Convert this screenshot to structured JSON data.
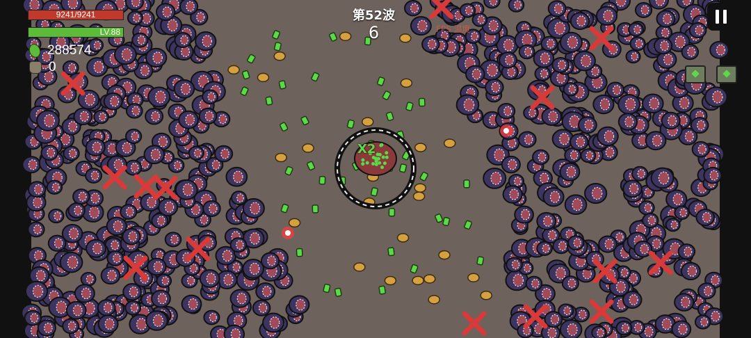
{
  "hud": {
    "hp_text": "9241/9241",
    "level_text": "LV.88",
    "gems": "288574",
    "bag_count": "0",
    "wave_label": "第52波",
    "wave_count": "6",
    "fps_text": "FPS  温度 ",
    "pause_icon": "pause-icon"
  },
  "world": {
    "multiplier_text": "X2",
    "chest_icon": "chest-icon"
  },
  "colors": {
    "hp": "#c0392b",
    "xp": "#5dbb3a",
    "ground": "#6e625c",
    "enemy": "#3d3560",
    "enemy_mouth": "#a04a5a",
    "gem": "#5dd84a",
    "coin": "#d4a040",
    "cross": "#d83a3a"
  }
}
